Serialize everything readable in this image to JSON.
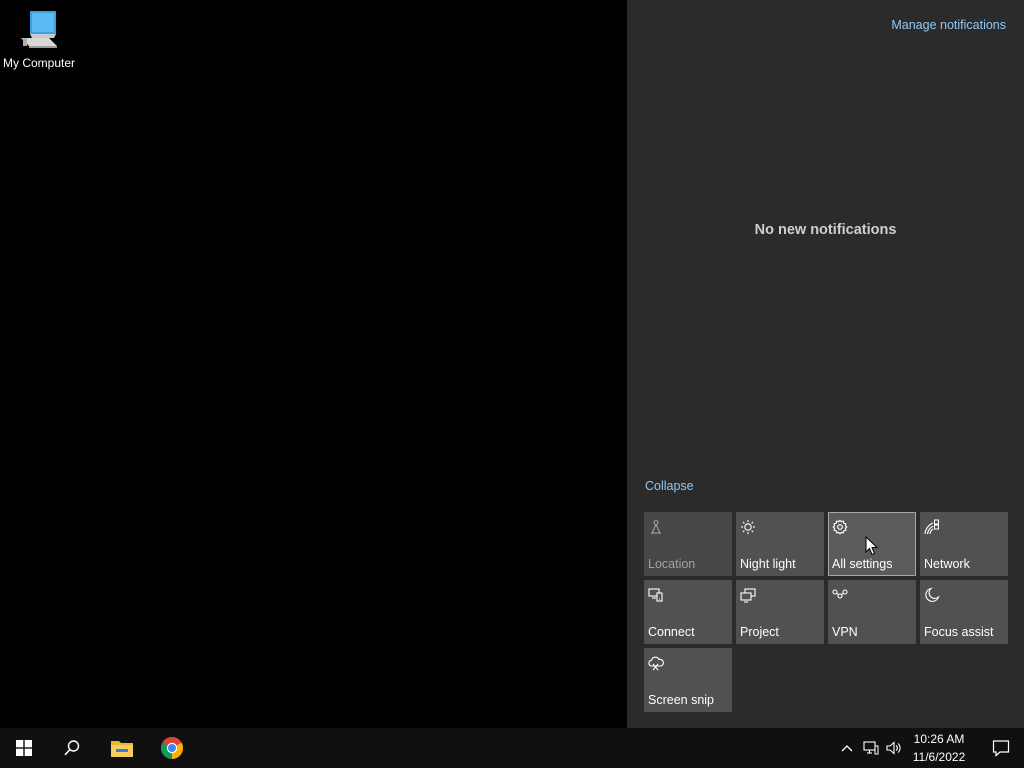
{
  "desktop": {
    "icons": [
      {
        "label": "My Computer",
        "icon": "computer-icon"
      }
    ]
  },
  "action_center": {
    "manage_label": "Manage notifications",
    "empty_label": "No new notifications",
    "collapse_label": "Collapse",
    "tiles": [
      {
        "label": "Location",
        "icon": "location-icon",
        "state": "disabled"
      },
      {
        "label": "Night light",
        "icon": "night-light-icon",
        "state": "normal"
      },
      {
        "label": "All settings",
        "icon": "gear-icon",
        "state": "hover"
      },
      {
        "label": "Network",
        "icon": "network-icon",
        "state": "normal"
      },
      {
        "label": "Connect",
        "icon": "connect-icon",
        "state": "normal"
      },
      {
        "label": "Project",
        "icon": "project-icon",
        "state": "normal"
      },
      {
        "label": "VPN",
        "icon": "vpn-icon",
        "state": "normal"
      },
      {
        "label": "Focus assist",
        "icon": "moon-icon",
        "state": "normal"
      },
      {
        "label": "Screen snip",
        "icon": "screen-snip-icon",
        "state": "normal"
      }
    ]
  },
  "taskbar": {
    "pinned": [
      {
        "name": "start",
        "icon": "windows-logo-icon"
      },
      {
        "name": "search",
        "icon": "search-icon"
      },
      {
        "name": "file-explorer",
        "icon": "folder-icon"
      },
      {
        "name": "chrome",
        "icon": "chrome-icon"
      }
    ],
    "tray": [
      "chevron-up-icon",
      "network-tray-icon",
      "volume-icon"
    ],
    "clock": {
      "time": "10:26 AM",
      "date": "11/6/2022"
    },
    "notification_icon": "notification-icon"
  },
  "colors": {
    "accent_link": "#8fc8f5",
    "panel_bg": "#2b2b2b",
    "tile_bg": "#515151",
    "taskbar_bg": "#101010"
  }
}
